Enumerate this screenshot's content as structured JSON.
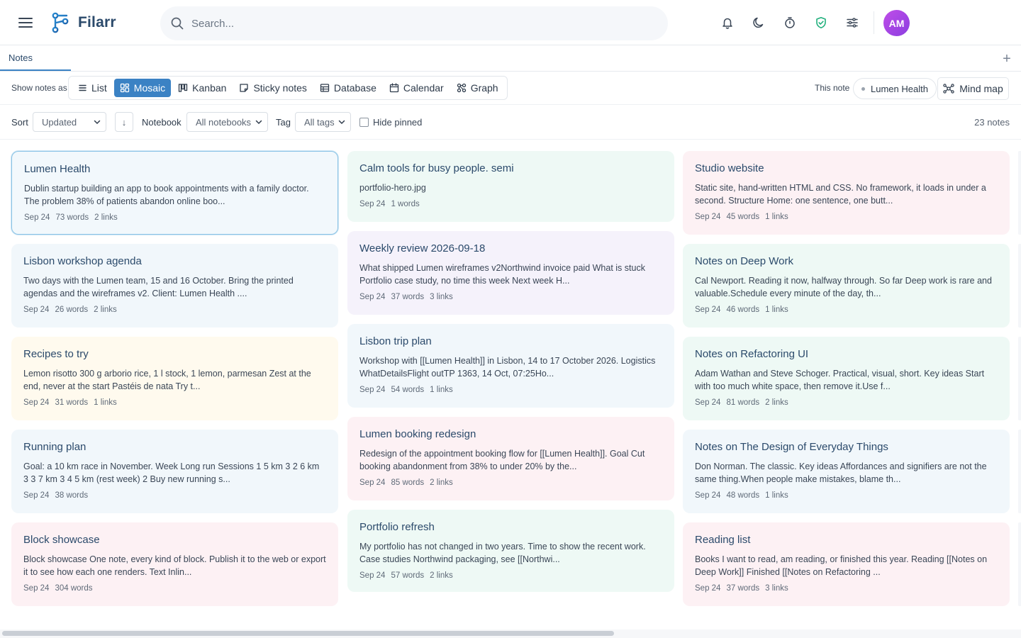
{
  "app": {
    "name": "Filarr",
    "brand_color": "#3b82c4",
    "logo_icon": "filarr-logo-icon"
  },
  "header": {
    "search_placeholder": "Search...",
    "icons": [
      "bell-icon",
      "moon-icon",
      "timer-icon",
      "shield-check-icon",
      "sliders-icon"
    ],
    "avatar_initials": "AM"
  },
  "tabs": {
    "active_label": "Notes",
    "add_label": "+"
  },
  "views": {
    "label": "Show notes as",
    "items": [
      {
        "label": "List",
        "icon": "list-icon"
      },
      {
        "label": "Mosaic",
        "icon": "mosaic-icon",
        "active": true
      },
      {
        "label": "Kanban",
        "icon": "kanban-icon"
      },
      {
        "label": "Sticky notes",
        "icon": "sticky-note-icon"
      },
      {
        "label": "Database",
        "icon": "database-icon"
      },
      {
        "label": "Calendar",
        "icon": "calendar-icon"
      },
      {
        "label": "Graph",
        "icon": "graph-icon"
      }
    ],
    "this_note_label": "This note",
    "this_note_value": "Lumen Health",
    "mind_map_label": "Mind map"
  },
  "filters": {
    "sort_label": "Sort",
    "sort_value": "Updated",
    "order_label": "↓",
    "notebook_label": "Notebook",
    "notebook_value": "All notebooks",
    "tag_label": "Tag",
    "tag_value": "All tags",
    "hide_pinned_label": "Hide pinned",
    "hide_pinned_checked": false,
    "count_label": "23 notes"
  },
  "notes": [
    {
      "title": "Lumen Health",
      "body": "Dublin startup building an app to book appointments with a family doctor. The problem 38% of patients abandon online boo...",
      "date": "Sep 24",
      "words": "73 words",
      "links": "2 links",
      "color": "blue",
      "selected": true
    },
    {
      "title": "Calm tools for busy people. semi",
      "body": "portfolio-hero.jpg",
      "date": "Sep 24",
      "words": "1 words",
      "links": "",
      "color": "mint"
    },
    {
      "title": "Studio website",
      "body": "Static site, hand-written HTML and CSS. No framework, it loads in under a second. Structure Home: one sentence, one butt...",
      "date": "Sep 24",
      "words": "45 words",
      "links": "1 links",
      "color": "pink"
    },
    {
      "title": "Lisbon workshop agenda",
      "body": "Two days with the Lumen team, 15 and 16 October. Bring the printed agendas and the wireframes v2. Client: Lumen Health ....",
      "date": "Sep 24",
      "words": "26 words",
      "links": "2 links",
      "color": "blue"
    },
    {
      "title": "Weekly review 2026-09-18",
      "body": "What shipped Lumen wireframes v2Northwind invoice paid What is stuck Portfolio case study, no time this week Next week H...",
      "date": "Sep 24",
      "words": "37 words",
      "links": "3 links",
      "color": "lav"
    },
    {
      "title": "Notes on Deep Work",
      "body": "Cal Newport. Reading it now, halfway through. So far Deep work is rare and valuable.Schedule every minute of the day, th...",
      "date": "Sep 24",
      "words": "46 words",
      "links": "1 links",
      "color": "mint"
    },
    {
      "title": "Recipes to try",
      "body": "Lemon risotto 300 g arborio rice, 1 l stock, 1 lemon, parmesan Zest at the end, never at the start Pastéis de nata Try t...",
      "date": "Sep 24",
      "words": "31 words",
      "links": "1 links",
      "color": "yellow"
    },
    {
      "title": "Lisbon trip plan",
      "body": "Workshop with [[Lumen Health]] in Lisbon, 14 to 17 October 2026. Logistics WhatDetailsFlight outTP 1363, 14 Oct, 07:25Ho...",
      "date": "Sep 24",
      "words": "54 words",
      "links": "1 links",
      "color": "blue"
    },
    {
      "title": "Notes on Refactoring UI",
      "body": "Adam Wathan and Steve Schoger. Practical, visual, short. Key ideas Start with too much white space, then remove it.Use f...",
      "date": "Sep 24",
      "words": "81 words",
      "links": "2 links",
      "color": "mint"
    },
    {
      "title": "Running plan",
      "body": "Goal: a 10 km race in November. Week Long run Sessions 1 5 km 3 2 6 km 3 3 7 km 3 4 5 km (rest week) 2 Buy new running s...",
      "date": "Sep 24",
      "words": "38 words",
      "links": "",
      "color": "blue"
    },
    {
      "title": "Lumen booking redesign",
      "body": "Redesign of the appointment booking flow for [[Lumen Health]]. Goal Cut booking abandonment from 38% to under 20% by the...",
      "date": "Sep 24",
      "words": "85 words",
      "links": "2 links",
      "color": "pink"
    },
    {
      "title": "Notes on The Design of Everyday Things",
      "body": "Don Norman. The classic. Key ideas Affordances and signifiers are not the same thing.When people make mistakes, blame th...",
      "date": "Sep 24",
      "words": "48 words",
      "links": "1 links",
      "color": "blue"
    },
    {
      "title": "Block showcase",
      "body": "Block showcase One note, every kind of block. Publish it to the web or export it to see how each one renders. Text Inlin...",
      "date": "Sep 24",
      "words": "304 words",
      "links": "",
      "color": "pink"
    },
    {
      "title": "Portfolio refresh",
      "body": "My portfolio has not changed in two years. Time to show the recent work. Case studies Northwind packaging, see [[Northwi...",
      "date": "Sep 24",
      "words": "57 words",
      "links": "2 links",
      "color": "mint"
    },
    {
      "title": "Reading list",
      "body": "Books I want to read, am reading, or finished this year. Reading [[Notes on Deep Work]] Finished [[Notes on Refactoring ...",
      "date": "Sep 24",
      "words": "37 words",
      "links": "3 links",
      "color": "pink"
    }
  ]
}
